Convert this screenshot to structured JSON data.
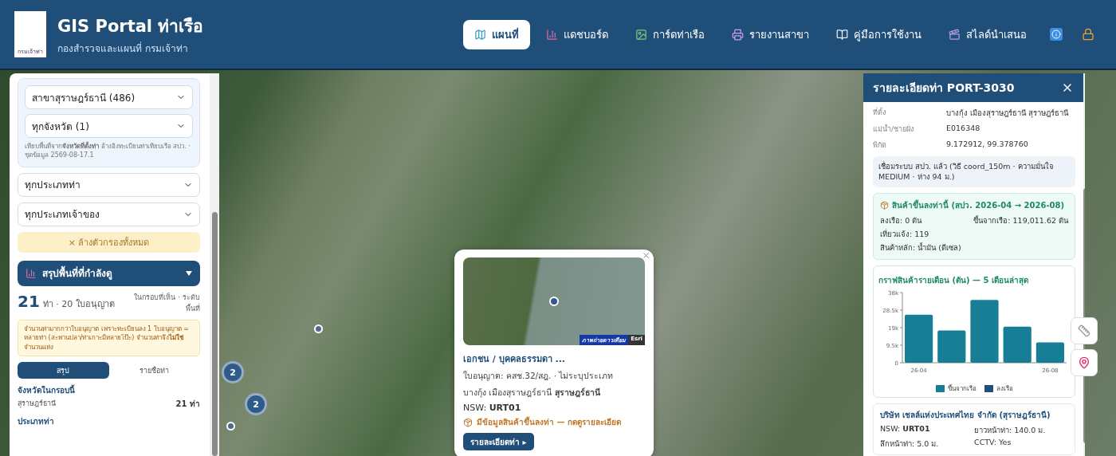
{
  "header": {
    "title": "GIS Portal ท่าเรือ",
    "subtitle": "กองสำรวจและแผนที่ กรมเจ้าท่า",
    "logo_text": "กรมเจ้าท่า",
    "nav": [
      {
        "label": "แผนที่",
        "selected": true
      },
      {
        "label": "แดชบอร์ด",
        "selected": false
      },
      {
        "label": "การ์ดท่าเรือ",
        "selected": false
      },
      {
        "label": "รายงานสาขา",
        "selected": false
      },
      {
        "label": "คู่มือการใช้งาน",
        "selected": false
      },
      {
        "label": "สไลด์นำเสนอ",
        "selected": false
      }
    ]
  },
  "left_panel": {
    "filter_box": {
      "selects": [
        "สาขาสุราษฎร์ธานี (486)",
        "ทุกจังหวัด (1)"
      ],
      "note": "เทียบพื้นที่จาก**จังหวัดที่ตั้งท่า** อ้างอิงทะเบียนท่าเทียบเรือ สปว. · ชุดข้อมูล 2569-08-17.1"
    },
    "selects": [
      "ทุกประเภทท่า",
      "ทุกประเภทเจ้าของ"
    ],
    "clear_button": "× ล้างตัวกรองทั้งหมด",
    "summary": {
      "title": "สรุปพื้นที่ที่กำลังดู",
      "expanded": true,
      "count": "21",
      "count_text": "ท่า · 20 ใบอนุญาต",
      "scope": "ในกรอบที่เห็น · ระดับพื้นที่",
      "warning": "จำนวนท่ามากกว่าใบอนุญาต เพราะทะเบียนลง 1 ใบอนุญาต = หลายท่า (สะพานปลา/ท่าเกาะมีหลายโป๊ะ) จำนวนท่าจึง**ไม่ใช่**จำนวนแห่ง",
      "tabs": [
        {
          "label": "สรุป",
          "selected": true
        },
        {
          "label": "รายชื่อท่า",
          "selected": false
        }
      ],
      "groups": [
        {
          "heading": "จังหวัดในกรอบนี้",
          "rows": [
            {
              "label": "สุราษฎร์ธานี",
              "value": "21 ท่า"
            }
          ]
        },
        {
          "heading": "ประเภทท่า"
        }
      ]
    }
  },
  "map": {
    "clusters": [
      {
        "label": "2"
      },
      {
        "label": "2"
      }
    ]
  },
  "popup": {
    "photo_caption": "ภาพถ่ายดาวเทียม",
    "attribution": "Esri",
    "title": "เอกชน / บุคคลธรรมดา ...",
    "license": "ใบอนุญาต: คสช.32/สฎ. · ไม่ระบุประเภท",
    "location": "บางกุ้ง เมืองสุราษฎร์ธานี **สุราษฎร์ธานี**",
    "nsw": "NSW: **URT01**",
    "cargo_note": "มีข้อมูลสินค้าขึ้นลงท่า — กดดูรายละเอียด",
    "button": "รายละเอียดท่า ▸"
  },
  "detail_panel": {
    "title": "รายละเอียดท่า PORT-3030",
    "fields": [
      {
        "label": "ที่ตั้ง",
        "value": "บางกุ้ง เมืองสุราษฎร์ธานี สุราษฎร์ธานี"
      },
      {
        "label": "แม่น้ำ/ชายฝั่ง",
        "value": "E016348"
      },
      {
        "label": "พิกัด",
        "value": "9.172912, 99.378760"
      }
    ],
    "link_note": "เชื่อมระบบ สปว. แล้ว (วิธี coord_150m · ความมั่นใจ MEDIUM · ห่าง 94 ม.)",
    "cargo": {
      "title": "สินค้าขึ้นลงท่านี้ (สปว. 2026-04 → 2026-08)",
      "lines": [
        {
          "text": "ลงเรือ: 0 ตัน",
          "kind": "left"
        },
        {
          "text": "ขึ้นจากเรือ: 119,011.62 ตัน",
          "kind": "right"
        },
        {
          "text": "เที่ยวแจ้ง: 119",
          "kind": "full"
        },
        {
          "text": "สินค้าหลัก: น้ำมัน (ดีเซล)",
          "kind": "full"
        }
      ]
    },
    "chart_card": {
      "title": "กราฟสินค้ารายเดือน (ตัน) — 5 เดือนล่าสุด",
      "chart_data": {
        "type": "bar",
        "categories": [
          "26-04",
          null,
          null,
          null,
          "26-08"
        ],
        "ylim": [
          0,
          38000
        ],
        "yticks": [
          {
            "value": 0,
            "label": "0"
          },
          {
            "value": 9500,
            "label": "9.5k"
          },
          {
            "value": 19000,
            "label": "19k"
          },
          {
            "value": 28500,
            "label": "28.5k"
          },
          {
            "value": 38000,
            "label": "38k"
          }
        ],
        "series": [
          {
            "name": "ขึ้นจากเรือ",
            "color": "#177e96",
            "values": [
              26000,
              17500,
              34000,
              19500,
              11000
            ]
          },
          {
            "name": "ลงเรือ",
            "color": "#1f4e79",
            "values": [
              0,
              0,
              0,
              0,
              0
            ]
          }
        ]
      }
    },
    "company": {
      "name": "บริษัท เชลล์แห่งประเทศไทย จำกัด (สุราษฎร์ธานี)",
      "facts": [
        "NSW: **URT01**",
        "ยาวหน้าท่า: 140.0 ม.",
        "ลึกหน้าท่า: 5.0 ม.",
        "CCTV: Yes"
      ]
    }
  }
}
